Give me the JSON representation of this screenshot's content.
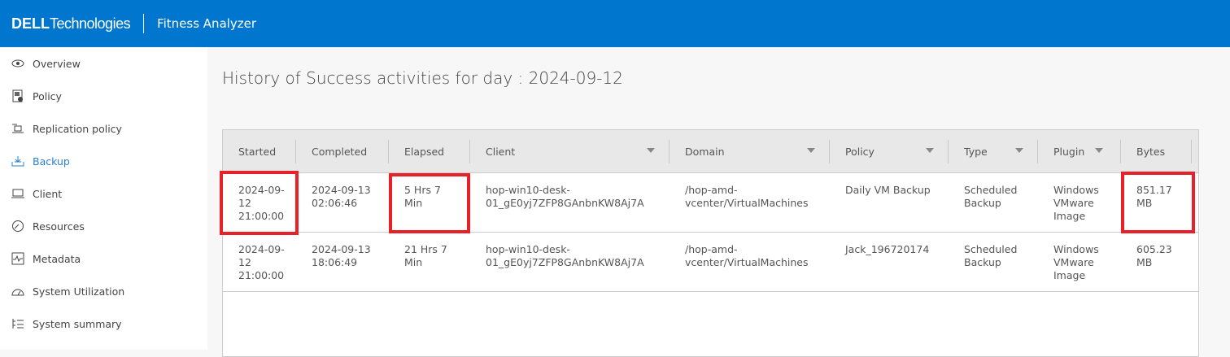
{
  "header": {
    "brand_bold": "DELL",
    "brand_light": "Technologies",
    "app_title": "Fitness Analyzer",
    "color": "#0176ce"
  },
  "sidebar": {
    "items": [
      {
        "label": "Overview",
        "icon": "eye-icon"
      },
      {
        "label": "Policy",
        "icon": "policy-icon"
      },
      {
        "label": "Replication policy",
        "icon": "replication-icon"
      },
      {
        "label": "Backup",
        "icon": "backup-icon",
        "active": true
      },
      {
        "label": "Client",
        "icon": "laptop-icon"
      },
      {
        "label": "Resources",
        "icon": "gauge-icon"
      },
      {
        "label": "Metadata",
        "icon": "pulse-icon"
      },
      {
        "label": "System Utilization",
        "icon": "speedometer-icon"
      },
      {
        "label": "System summary",
        "icon": "list-tree-icon"
      }
    ]
  },
  "page_title": "History of Success activities for day : 2024-09-12",
  "table": {
    "columns": [
      {
        "label": "Started",
        "filter": false
      },
      {
        "label": "Completed",
        "filter": false
      },
      {
        "label": "Elapsed",
        "filter": false
      },
      {
        "label": "Client",
        "filter": true
      },
      {
        "label": "Domain",
        "filter": true
      },
      {
        "label": "Policy",
        "filter": true
      },
      {
        "label": "Type",
        "filter": true
      },
      {
        "label": "Plugin",
        "filter": true
      },
      {
        "label": "Bytes",
        "filter": false
      }
    ],
    "rows": [
      [
        "2024-09-\n12\n21:00:00",
        "2024-09-13\n02:06:46",
        "5 Hrs 7\nMin",
        "hop-win10-desk-\n01_gE0yj7ZFP8GAnbnKW8Aj7A",
        "/hop-amd-\nvcenter/VirtualMachines",
        "Daily VM Backup",
        "Scheduled\nBackup",
        "Windows\nVMware\nImage",
        "851.17\nMB"
      ],
      [
        "2024-09-\n12\n21:00:00",
        "2024-09-13\n18:06:49",
        "21 Hrs 7\nMin",
        "hop-win10-desk-\n01_gE0yj7ZFP8GAnbnKW8Aj7A",
        "/hop-amd-\nvcenter/VirtualMachines",
        "Jack_196720174",
        "Scheduled\nBackup",
        "Windows\nVMware\nImage",
        "605.23\nMB"
      ]
    ]
  },
  "highlight_color": "#e8202a"
}
